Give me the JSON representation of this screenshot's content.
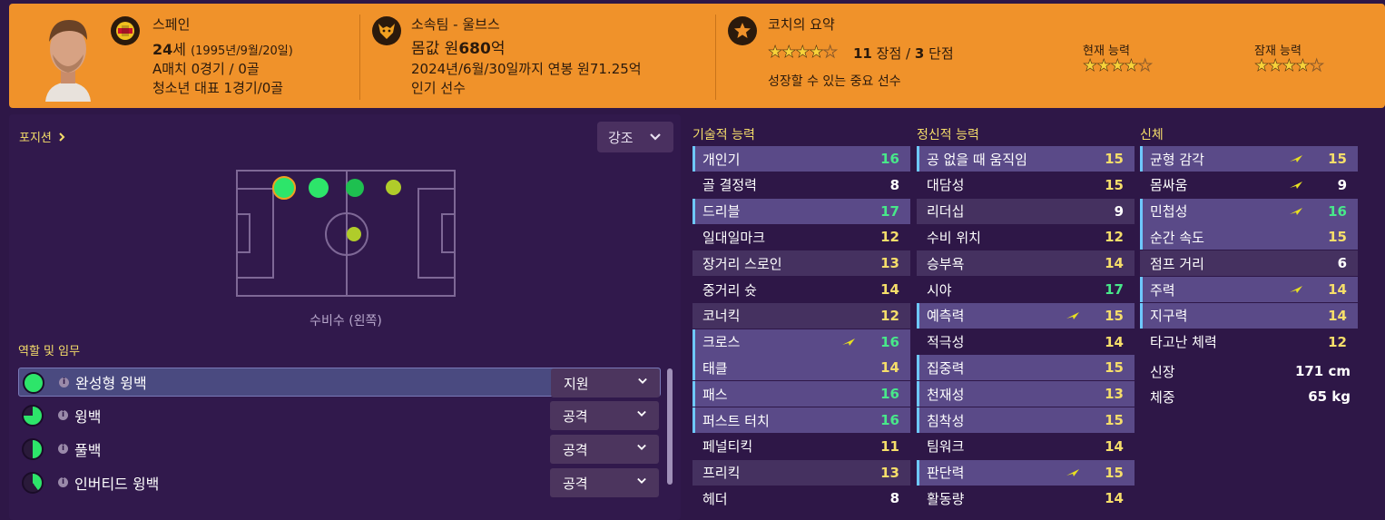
{
  "header": {
    "nation": "스페인",
    "age": "24",
    "age_suffix": "세",
    "birth": "(1995년/9월/20일)",
    "caps": "A매치 0경기 / 0골",
    "youth_caps": "청소년 대표 1경기/0골",
    "club": "소속팀 - 울브스",
    "value_prefix": "몸값 원",
    "value": "680",
    "value_suffix": "억",
    "contract": "2024년/6월/30일까지 연봉 원71.25억",
    "popularity": "인기 선수",
    "coach_title": "코치의 요약",
    "strengths_count": "11",
    "strengths_label": "장점 /",
    "weaknesses_count": "3",
    "weaknesses_label": "단점",
    "summary": "성장할 수 있는 중요 선수",
    "current_label": "현재 능력",
    "potential_label": "잠재 능력",
    "coach_stars": 4,
    "current_stars": 4,
    "potential_stars": 4,
    "max_stars": 5
  },
  "left": {
    "position_link": "포지션",
    "emphasis_button": "강조",
    "position_name": "수비수 (왼쪽)",
    "roles_title": "역할 및 임무",
    "roles": [
      {
        "name": "완성형 윙백",
        "duty": "지원",
        "fill": 1.0
      },
      {
        "name": "윙백",
        "duty": "공격",
        "fill": 0.75
      },
      {
        "name": "풀백",
        "duty": "공격",
        "fill": 0.5
      },
      {
        "name": "인버티드 윙백",
        "duty": "공격",
        "fill": 0.4
      }
    ]
  },
  "technical": {
    "title": "기술적 능력",
    "items": [
      {
        "name": "개인기",
        "value": "16"
      },
      {
        "name": "골 결정력",
        "value": "8"
      },
      {
        "name": "드리블",
        "value": "17"
      },
      {
        "name": "일대일마크",
        "value": "12"
      },
      {
        "name": "장거리 스로인",
        "value": "13"
      },
      {
        "name": "중거리 슛",
        "value": "14"
      },
      {
        "name": "코너킥",
        "value": "12"
      },
      {
        "name": "크로스",
        "value": "16"
      },
      {
        "name": "태클",
        "value": "14"
      },
      {
        "name": "패스",
        "value": "16"
      },
      {
        "name": "퍼스트 터치",
        "value": "16"
      },
      {
        "name": "페널티킥",
        "value": "11"
      },
      {
        "name": "프리킥",
        "value": "13"
      },
      {
        "name": "헤더",
        "value": "8"
      }
    ]
  },
  "mental": {
    "title": "정신적 능력",
    "items": [
      {
        "name": "공 없을 때 움직임",
        "value": "15"
      },
      {
        "name": "대담성",
        "value": "15"
      },
      {
        "name": "리더십",
        "value": "9"
      },
      {
        "name": "수비 위치",
        "value": "12"
      },
      {
        "name": "승부욕",
        "value": "14"
      },
      {
        "name": "시야",
        "value": "17"
      },
      {
        "name": "예측력",
        "value": "15"
      },
      {
        "name": "적극성",
        "value": "14"
      },
      {
        "name": "집중력",
        "value": "15"
      },
      {
        "name": "천재성",
        "value": "13"
      },
      {
        "name": "침착성",
        "value": "15"
      },
      {
        "name": "팀워크",
        "value": "14"
      },
      {
        "name": "판단력",
        "value": "15"
      },
      {
        "name": "활동량",
        "value": "14"
      }
    ]
  },
  "physical": {
    "title": "신체",
    "items": [
      {
        "name": "균형 감각",
        "value": "15"
      },
      {
        "name": "몸싸움",
        "value": "9"
      },
      {
        "name": "민첩성",
        "value": "16"
      },
      {
        "name": "순간 속도",
        "value": "15"
      },
      {
        "name": "점프 거리",
        "value": "6"
      },
      {
        "name": "주력",
        "value": "14"
      },
      {
        "name": "지구력",
        "value": "14"
      },
      {
        "name": "타고난 체력",
        "value": "12"
      }
    ],
    "height_label": "신장",
    "height": "171 cm",
    "weight_label": "체중",
    "weight": "65 kg"
  },
  "colors": {
    "header_bg": "#f0922a",
    "panel_bg": "#2e1747",
    "highlight": "#f6de6a",
    "green_value": "#48e88a",
    "key_bar": "#6ec8ff"
  }
}
